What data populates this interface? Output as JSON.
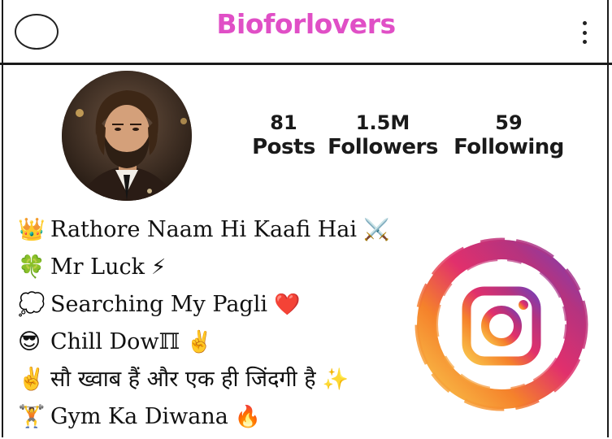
{
  "header": {
    "logo_text": "Bioforlovers",
    "logo_color": "#e04fc6"
  },
  "profile": {
    "avatar": "profile-photo",
    "stats": [
      {
        "value": "81",
        "label": "Posts"
      },
      {
        "value": "1.5M",
        "label": "Followers"
      },
      {
        "value": "59",
        "label": "Following"
      }
    ]
  },
  "bio": [
    {
      "emoji": "👑",
      "text": "Rathore Naam Hi Kaafi Hai",
      "trail": "⚔️"
    },
    {
      "emoji": "🍀",
      "text": "Mr Luck",
      "trail": "⚡"
    },
    {
      "emoji": "💭",
      "text": "Searching My Pagli",
      "trail": "❤️"
    },
    {
      "emoji": "😎",
      "text": "Chill Dowℿ",
      "trail": "✌️"
    },
    {
      "emoji": "✌️",
      "text": "सौ ख्वाब हैं और एक ही जिंदगी है",
      "trail": "✨"
    },
    {
      "emoji": "🏋️",
      "text": "Gym Ka Diwana",
      "trail": "🔥"
    }
  ],
  "decor": {
    "logo_icon": "instagram-icon"
  }
}
